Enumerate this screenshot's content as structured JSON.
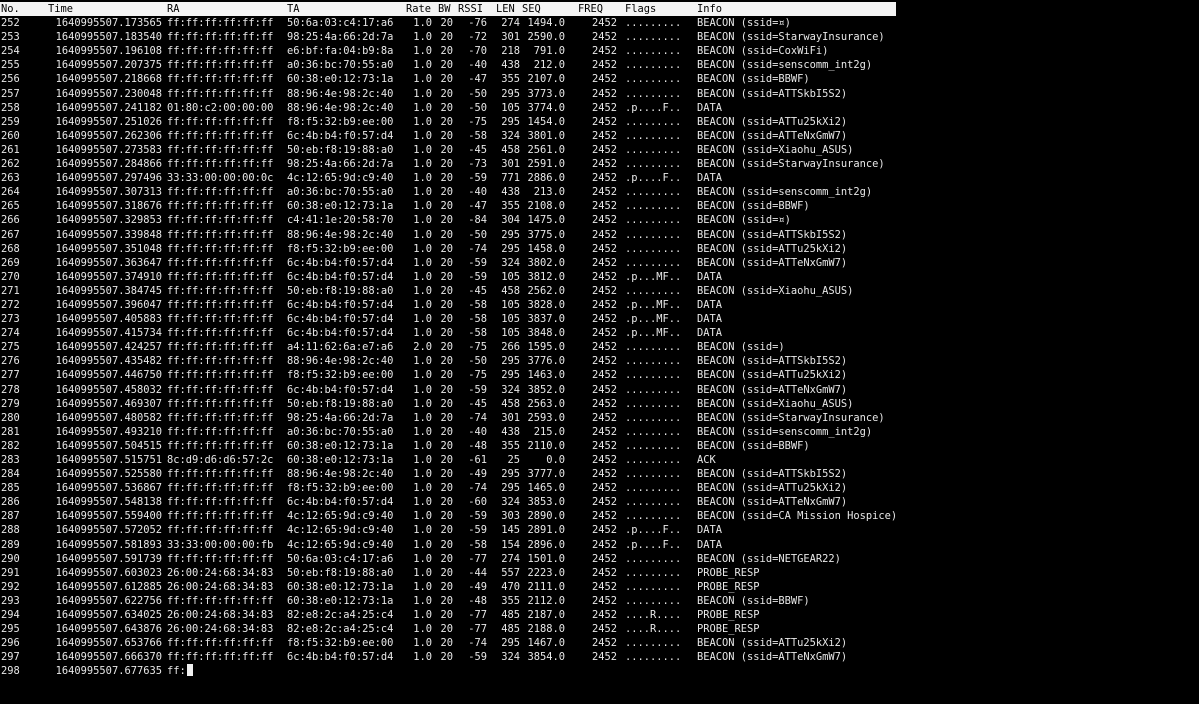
{
  "colors": {
    "background": "#000000",
    "text": "#e8e8e8",
    "header_bg": "#f4f4f4",
    "header_text": "#000000"
  },
  "header": {
    "no": "No.",
    "time": "Time",
    "ra": "RA",
    "ta": "TA",
    "rate": "Rate",
    "bw": "BW",
    "rssi": "RSSI",
    "len": "LEN",
    "seq": "SEQ",
    "freq": "FREQ",
    "flags": "Flags",
    "info": "Info"
  },
  "rows": [
    {
      "no": "252",
      "time": "1640995507.173565",
      "ra": "ff:ff:ff:ff:ff:ff",
      "ta": "50:6a:03:c4:17:a6",
      "rate": "1.0",
      "bw": "20",
      "rssi": "-76",
      "len": "274",
      "seq": "1494.0",
      "freq": "2452",
      "flags": ".........",
      "info": "BEACON (ssid=¤)"
    },
    {
      "no": "253",
      "time": "1640995507.183540",
      "ra": "ff:ff:ff:ff:ff:ff",
      "ta": "98:25:4a:66:2d:7a",
      "rate": "1.0",
      "bw": "20",
      "rssi": "-72",
      "len": "301",
      "seq": "2590.0",
      "freq": "2452",
      "flags": ".........",
      "info": "BEACON (ssid=StarwayInsurance)"
    },
    {
      "no": "254",
      "time": "1640995507.196108",
      "ra": "ff:ff:ff:ff:ff:ff",
      "ta": "e6:bf:fa:04:b9:8a",
      "rate": "1.0",
      "bw": "20",
      "rssi": "-70",
      "len": "218",
      "seq": "791.0",
      "freq": "2452",
      "flags": ".........",
      "info": "BEACON (ssid=CoxWiFi)"
    },
    {
      "no": "255",
      "time": "1640995507.207375",
      "ra": "ff:ff:ff:ff:ff:ff",
      "ta": "a0:36:bc:70:55:a0",
      "rate": "1.0",
      "bw": "20",
      "rssi": "-40",
      "len": "438",
      "seq": "212.0",
      "freq": "2452",
      "flags": ".........",
      "info": "BEACON (ssid=senscomm_int2g)"
    },
    {
      "no": "256",
      "time": "1640995507.218668",
      "ra": "ff:ff:ff:ff:ff:ff",
      "ta": "60:38:e0:12:73:1a",
      "rate": "1.0",
      "bw": "20",
      "rssi": "-47",
      "len": "355",
      "seq": "2107.0",
      "freq": "2452",
      "flags": ".........",
      "info": "BEACON (ssid=BBWF)"
    },
    {
      "no": "257",
      "time": "1640995507.230048",
      "ra": "ff:ff:ff:ff:ff:ff",
      "ta": "88:96:4e:98:2c:40",
      "rate": "1.0",
      "bw": "20",
      "rssi": "-50",
      "len": "295",
      "seq": "3773.0",
      "freq": "2452",
      "flags": ".........",
      "info": "BEACON (ssid=ATTSkbI5S2)"
    },
    {
      "no": "258",
      "time": "1640995507.241182",
      "ra": "01:80:c2:00:00:00",
      "ta": "88:96:4e:98:2c:40",
      "rate": "1.0",
      "bw": "20",
      "rssi": "-50",
      "len": "105",
      "seq": "3774.0",
      "freq": "2452",
      "flags": ".p....F..",
      "info": "DATA"
    },
    {
      "no": "259",
      "time": "1640995507.251026",
      "ra": "ff:ff:ff:ff:ff:ff",
      "ta": "f8:f5:32:b9:ee:00",
      "rate": "1.0",
      "bw": "20",
      "rssi": "-75",
      "len": "295",
      "seq": "1454.0",
      "freq": "2452",
      "flags": ".........",
      "info": "BEACON (ssid=ATTu25kXi2)"
    },
    {
      "no": "260",
      "time": "1640995507.262306",
      "ra": "ff:ff:ff:ff:ff:ff",
      "ta": "6c:4b:b4:f0:57:d4",
      "rate": "1.0",
      "bw": "20",
      "rssi": "-58",
      "len": "324",
      "seq": "3801.0",
      "freq": "2452",
      "flags": ".........",
      "info": "BEACON (ssid=ATTeNxGmW7)"
    },
    {
      "no": "261",
      "time": "1640995507.273583",
      "ra": "ff:ff:ff:ff:ff:ff",
      "ta": "50:eb:f8:19:88:a0",
      "rate": "1.0",
      "bw": "20",
      "rssi": "-45",
      "len": "458",
      "seq": "2561.0",
      "freq": "2452",
      "flags": ".........",
      "info": "BEACON (ssid=Xiaohu_ASUS)"
    },
    {
      "no": "262",
      "time": "1640995507.284866",
      "ra": "ff:ff:ff:ff:ff:ff",
      "ta": "98:25:4a:66:2d:7a",
      "rate": "1.0",
      "bw": "20",
      "rssi": "-73",
      "len": "301",
      "seq": "2591.0",
      "freq": "2452",
      "flags": ".........",
      "info": "BEACON (ssid=StarwayInsurance)"
    },
    {
      "no": "263",
      "time": "1640995507.297496",
      "ra": "33:33:00:00:00:0c",
      "ta": "4c:12:65:9d:c9:40",
      "rate": "1.0",
      "bw": "20",
      "rssi": "-59",
      "len": "771",
      "seq": "2886.0",
      "freq": "2452",
      "flags": ".p....F..",
      "info": "DATA"
    },
    {
      "no": "264",
      "time": "1640995507.307313",
      "ra": "ff:ff:ff:ff:ff:ff",
      "ta": "a0:36:bc:70:55:a0",
      "rate": "1.0",
      "bw": "20",
      "rssi": "-40",
      "len": "438",
      "seq": "213.0",
      "freq": "2452",
      "flags": ".........",
      "info": "BEACON (ssid=senscomm_int2g)"
    },
    {
      "no": "265",
      "time": "1640995507.318676",
      "ra": "ff:ff:ff:ff:ff:ff",
      "ta": "60:38:e0:12:73:1a",
      "rate": "1.0",
      "bw": "20",
      "rssi": "-47",
      "len": "355",
      "seq": "2108.0",
      "freq": "2452",
      "flags": ".........",
      "info": "BEACON (ssid=BBWF)"
    },
    {
      "no": "266",
      "time": "1640995507.329853",
      "ra": "ff:ff:ff:ff:ff:ff",
      "ta": "c4:41:1e:20:58:70",
      "rate": "1.0",
      "bw": "20",
      "rssi": "-84",
      "len": "304",
      "seq": "1475.0",
      "freq": "2452",
      "flags": ".........",
      "info": "BEACON (ssid=¤)"
    },
    {
      "no": "267",
      "time": "1640995507.339848",
      "ra": "ff:ff:ff:ff:ff:ff",
      "ta": "88:96:4e:98:2c:40",
      "rate": "1.0",
      "bw": "20",
      "rssi": "-50",
      "len": "295",
      "seq": "3775.0",
      "freq": "2452",
      "flags": ".........",
      "info": "BEACON (ssid=ATTSkbI5S2)"
    },
    {
      "no": "268",
      "time": "1640995507.351048",
      "ra": "ff:ff:ff:ff:ff:ff",
      "ta": "f8:f5:32:b9:ee:00",
      "rate": "1.0",
      "bw": "20",
      "rssi": "-74",
      "len": "295",
      "seq": "1458.0",
      "freq": "2452",
      "flags": ".........",
      "info": "BEACON (ssid=ATTu25kXi2)"
    },
    {
      "no": "269",
      "time": "1640995507.363647",
      "ra": "ff:ff:ff:ff:ff:ff",
      "ta": "6c:4b:b4:f0:57:d4",
      "rate": "1.0",
      "bw": "20",
      "rssi": "-59",
      "len": "324",
      "seq": "3802.0",
      "freq": "2452",
      "flags": ".........",
      "info": "BEACON (ssid=ATTeNxGmW7)"
    },
    {
      "no": "270",
      "time": "1640995507.374910",
      "ra": "ff:ff:ff:ff:ff:ff",
      "ta": "6c:4b:b4:f0:57:d4",
      "rate": "1.0",
      "bw": "20",
      "rssi": "-59",
      "len": "105",
      "seq": "3812.0",
      "freq": "2452",
      "flags": ".p...MF..",
      "info": "DATA"
    },
    {
      "no": "271",
      "time": "1640995507.384745",
      "ra": "ff:ff:ff:ff:ff:ff",
      "ta": "50:eb:f8:19:88:a0",
      "rate": "1.0",
      "bw": "20",
      "rssi": "-45",
      "len": "458",
      "seq": "2562.0",
      "freq": "2452",
      "flags": ".........",
      "info": "BEACON (ssid=Xiaohu_ASUS)"
    },
    {
      "no": "272",
      "time": "1640995507.396047",
      "ra": "ff:ff:ff:ff:ff:ff",
      "ta": "6c:4b:b4:f0:57:d4",
      "rate": "1.0",
      "bw": "20",
      "rssi": "-58",
      "len": "105",
      "seq": "3828.0",
      "freq": "2452",
      "flags": ".p...MF..",
      "info": "DATA"
    },
    {
      "no": "273",
      "time": "1640995507.405883",
      "ra": "ff:ff:ff:ff:ff:ff",
      "ta": "6c:4b:b4:f0:57:d4",
      "rate": "1.0",
      "bw": "20",
      "rssi": "-58",
      "len": "105",
      "seq": "3837.0",
      "freq": "2452",
      "flags": ".p...MF..",
      "info": "DATA"
    },
    {
      "no": "274",
      "time": "1640995507.415734",
      "ra": "ff:ff:ff:ff:ff:ff",
      "ta": "6c:4b:b4:f0:57:d4",
      "rate": "1.0",
      "bw": "20",
      "rssi": "-58",
      "len": "105",
      "seq": "3848.0",
      "freq": "2452",
      "flags": ".p...MF..",
      "info": "DATA"
    },
    {
      "no": "275",
      "time": "1640995507.424257",
      "ra": "ff:ff:ff:ff:ff:ff",
      "ta": "a4:11:62:6a:e7:a6",
      "rate": "2.0",
      "bw": "20",
      "rssi": "-75",
      "len": "266",
      "seq": "1595.0",
      "freq": "2452",
      "flags": ".........",
      "info": "BEACON (ssid=)"
    },
    {
      "no": "276",
      "time": "1640995507.435482",
      "ra": "ff:ff:ff:ff:ff:ff",
      "ta": "88:96:4e:98:2c:40",
      "rate": "1.0",
      "bw": "20",
      "rssi": "-50",
      "len": "295",
      "seq": "3776.0",
      "freq": "2452",
      "flags": ".........",
      "info": "BEACON (ssid=ATTSkbI5S2)"
    },
    {
      "no": "277",
      "time": "1640995507.446750",
      "ra": "ff:ff:ff:ff:ff:ff",
      "ta": "f8:f5:32:b9:ee:00",
      "rate": "1.0",
      "bw": "20",
      "rssi": "-75",
      "len": "295",
      "seq": "1463.0",
      "freq": "2452",
      "flags": ".........",
      "info": "BEACON (ssid=ATTu25kXi2)"
    },
    {
      "no": "278",
      "time": "1640995507.458032",
      "ra": "ff:ff:ff:ff:ff:ff",
      "ta": "6c:4b:b4:f0:57:d4",
      "rate": "1.0",
      "bw": "20",
      "rssi": "-59",
      "len": "324",
      "seq": "3852.0",
      "freq": "2452",
      "flags": ".........",
      "info": "BEACON (ssid=ATTeNxGmW7)"
    },
    {
      "no": "279",
      "time": "1640995507.469307",
      "ra": "ff:ff:ff:ff:ff:ff",
      "ta": "50:eb:f8:19:88:a0",
      "rate": "1.0",
      "bw": "20",
      "rssi": "-45",
      "len": "458",
      "seq": "2563.0",
      "freq": "2452",
      "flags": ".........",
      "info": "BEACON (ssid=Xiaohu_ASUS)"
    },
    {
      "no": "280",
      "time": "1640995507.480582",
      "ra": "ff:ff:ff:ff:ff:ff",
      "ta": "98:25:4a:66:2d:7a",
      "rate": "1.0",
      "bw": "20",
      "rssi": "-74",
      "len": "301",
      "seq": "2593.0",
      "freq": "2452",
      "flags": ".........",
      "info": "BEACON (ssid=StarwayInsurance)"
    },
    {
      "no": "281",
      "time": "1640995507.493210",
      "ra": "ff:ff:ff:ff:ff:ff",
      "ta": "a0:36:bc:70:55:a0",
      "rate": "1.0",
      "bw": "20",
      "rssi": "-40",
      "len": "438",
      "seq": "215.0",
      "freq": "2452",
      "flags": ".........",
      "info": "BEACON (ssid=senscomm_int2g)"
    },
    {
      "no": "282",
      "time": "1640995507.504515",
      "ra": "ff:ff:ff:ff:ff:ff",
      "ta": "60:38:e0:12:73:1a",
      "rate": "1.0",
      "bw": "20",
      "rssi": "-48",
      "len": "355",
      "seq": "2110.0",
      "freq": "2452",
      "flags": ".........",
      "info": "BEACON (ssid=BBWF)"
    },
    {
      "no": "283",
      "time": "1640995507.515751",
      "ra": "8c:d9:d6:d6:57:2c",
      "ta": "60:38:e0:12:73:1a",
      "rate": "1.0",
      "bw": "20",
      "rssi": "-61",
      "len": "25",
      "seq": "0.0",
      "freq": "2452",
      "flags": ".........",
      "info": "ACK"
    },
    {
      "no": "284",
      "time": "1640995507.525580",
      "ra": "ff:ff:ff:ff:ff:ff",
      "ta": "88:96:4e:98:2c:40",
      "rate": "1.0",
      "bw": "20",
      "rssi": "-49",
      "len": "295",
      "seq": "3777.0",
      "freq": "2452",
      "flags": ".........",
      "info": "BEACON (ssid=ATTSkbI5S2)"
    },
    {
      "no": "285",
      "time": "1640995507.536867",
      "ra": "ff:ff:ff:ff:ff:ff",
      "ta": "f8:f5:32:b9:ee:00",
      "rate": "1.0",
      "bw": "20",
      "rssi": "-74",
      "len": "295",
      "seq": "1465.0",
      "freq": "2452",
      "flags": ".........",
      "info": "BEACON (ssid=ATTu25kXi2)"
    },
    {
      "no": "286",
      "time": "1640995507.548138",
      "ra": "ff:ff:ff:ff:ff:ff",
      "ta": "6c:4b:b4:f0:57:d4",
      "rate": "1.0",
      "bw": "20",
      "rssi": "-60",
      "len": "324",
      "seq": "3853.0",
      "freq": "2452",
      "flags": ".........",
      "info": "BEACON (ssid=ATTeNxGmW7)"
    },
    {
      "no": "287",
      "time": "1640995507.559400",
      "ra": "ff:ff:ff:ff:ff:ff",
      "ta": "4c:12:65:9d:c9:40",
      "rate": "1.0",
      "bw": "20",
      "rssi": "-59",
      "len": "303",
      "seq": "2890.0",
      "freq": "2452",
      "flags": ".........",
      "info": "BEACON (ssid=CA Mission Hospice)"
    },
    {
      "no": "288",
      "time": "1640995507.572052",
      "ra": "ff:ff:ff:ff:ff:ff",
      "ta": "4c:12:65:9d:c9:40",
      "rate": "1.0",
      "bw": "20",
      "rssi": "-59",
      "len": "145",
      "seq": "2891.0",
      "freq": "2452",
      "flags": ".p....F..",
      "info": "DATA"
    },
    {
      "no": "289",
      "time": "1640995507.581893",
      "ra": "33:33:00:00:00:fb",
      "ta": "4c:12:65:9d:c9:40",
      "rate": "1.0",
      "bw": "20",
      "rssi": "-58",
      "len": "154",
      "seq": "2896.0",
      "freq": "2452",
      "flags": ".p....F..",
      "info": "DATA"
    },
    {
      "no": "290",
      "time": "1640995507.591739",
      "ra": "ff:ff:ff:ff:ff:ff",
      "ta": "50:6a:03:c4:17:a6",
      "rate": "1.0",
      "bw": "20",
      "rssi": "-77",
      "len": "274",
      "seq": "1501.0",
      "freq": "2452",
      "flags": ".........",
      "info": "BEACON (ssid=NETGEAR22)"
    },
    {
      "no": "291",
      "time": "1640995507.603023",
      "ra": "26:00:24:68:34:83",
      "ta": "50:eb:f8:19:88:a0",
      "rate": "1.0",
      "bw": "20",
      "rssi": "-44",
      "len": "557",
      "seq": "2223.0",
      "freq": "2452",
      "flags": ".........",
      "info": "PROBE_RESP"
    },
    {
      "no": "292",
      "time": "1640995507.612885",
      "ra": "26:00:24:68:34:83",
      "ta": "60:38:e0:12:73:1a",
      "rate": "1.0",
      "bw": "20",
      "rssi": "-49",
      "len": "470",
      "seq": "2111.0",
      "freq": "2452",
      "flags": ".........",
      "info": "PROBE_RESP"
    },
    {
      "no": "293",
      "time": "1640995507.622756",
      "ra": "ff:ff:ff:ff:ff:ff",
      "ta": "60:38:e0:12:73:1a",
      "rate": "1.0",
      "bw": "20",
      "rssi": "-48",
      "len": "355",
      "seq": "2112.0",
      "freq": "2452",
      "flags": ".........",
      "info": "BEACON (ssid=BBWF)"
    },
    {
      "no": "294",
      "time": "1640995507.634025",
      "ra": "26:00:24:68:34:83",
      "ta": "82:e8:2c:a4:25:c4",
      "rate": "1.0",
      "bw": "20",
      "rssi": "-77",
      "len": "485",
      "seq": "2187.0",
      "freq": "2452",
      "flags": "....R....",
      "info": "PROBE_RESP"
    },
    {
      "no": "295",
      "time": "1640995507.643876",
      "ra": "26:00:24:68:34:83",
      "ta": "82:e8:2c:a4:25:c4",
      "rate": "1.0",
      "bw": "20",
      "rssi": "-77",
      "len": "485",
      "seq": "2188.0",
      "freq": "2452",
      "flags": "....R....",
      "info": "PROBE_RESP"
    },
    {
      "no": "296",
      "time": "1640995507.653766",
      "ra": "ff:ff:ff:ff:ff:ff",
      "ta": "f8:f5:32:b9:ee:00",
      "rate": "1.0",
      "bw": "20",
      "rssi": "-74",
      "len": "295",
      "seq": "1467.0",
      "freq": "2452",
      "flags": ".........",
      "info": "BEACON (ssid=ATTu25kXi2)"
    },
    {
      "no": "297",
      "time": "1640995507.666370",
      "ra": "ff:ff:ff:ff:ff:ff",
      "ta": "6c:4b:b4:f0:57:d4",
      "rate": "1.0",
      "bw": "20",
      "rssi": "-59",
      "len": "324",
      "seq": "3854.0",
      "freq": "2452",
      "flags": ".........",
      "info": "BEACON (ssid=ATTeNxGmW7)"
    }
  ],
  "partial_row": {
    "no": "298",
    "time": "1640995507.677635",
    "ra": "ff:"
  }
}
